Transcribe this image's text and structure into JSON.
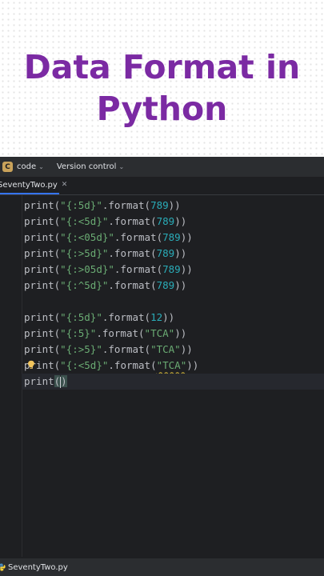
{
  "banner": {
    "title_line1": "Data Format in",
    "title_line2": "Python"
  },
  "toolbar": {
    "project_badge": "C",
    "project_name": "code",
    "vcs_label": "Version control"
  },
  "tab": {
    "filename": "SeventyTwo.py"
  },
  "statusbar": {
    "file": "SeventyTwo.py"
  },
  "code": {
    "l1": {
      "fn": "print",
      "str": "\"{:5d}\"",
      "method": ".format",
      "arg": "789"
    },
    "l2": {
      "fn": "print",
      "str": "\"{:<5d}\"",
      "method": ".format",
      "arg": "789"
    },
    "l3": {
      "fn": "print",
      "str": "\"{:<05d}\"",
      "method": ".format",
      "arg": "789"
    },
    "l4": {
      "fn": "print",
      "str": "\"{:>5d}\"",
      "method": ".format",
      "arg": "789"
    },
    "l5": {
      "fn": "print",
      "str": "\"{:>05d}\"",
      "method": ".format",
      "arg": "789"
    },
    "l6": {
      "fn": "print",
      "str": "\"{:^5d}\"",
      "method": ".format",
      "arg": "789"
    },
    "l8": {
      "fn": "print",
      "str": "\"{:5d}\"",
      "method": ".format",
      "arg": "12"
    },
    "l9": {
      "fn": "print",
      "str": "\"{:5}\"",
      "method": ".format",
      "arg": "\"TCA\""
    },
    "l10": {
      "fn": "print",
      "str": "\"{:>5}\"",
      "method": ".format",
      "arg": "\"TCA\""
    },
    "l11": {
      "fn": "print",
      "str": "\"{:<5d}\"",
      "method": ".format",
      "arg": "\"TCA\""
    },
    "l12": {
      "fn": "print"
    }
  },
  "colors": {
    "title": "#7b2aa3",
    "string": "#6aab73",
    "number": "#2aacb8",
    "editor_bg": "#1e1f22",
    "tab_underline": "#3574f0",
    "warning_underline": "#b8a035"
  },
  "icons": {
    "project": "project-badge",
    "chevron": "chevron-down-icon",
    "close": "close-icon",
    "intention": "lightbulb-icon",
    "python": "python-file-icon"
  }
}
